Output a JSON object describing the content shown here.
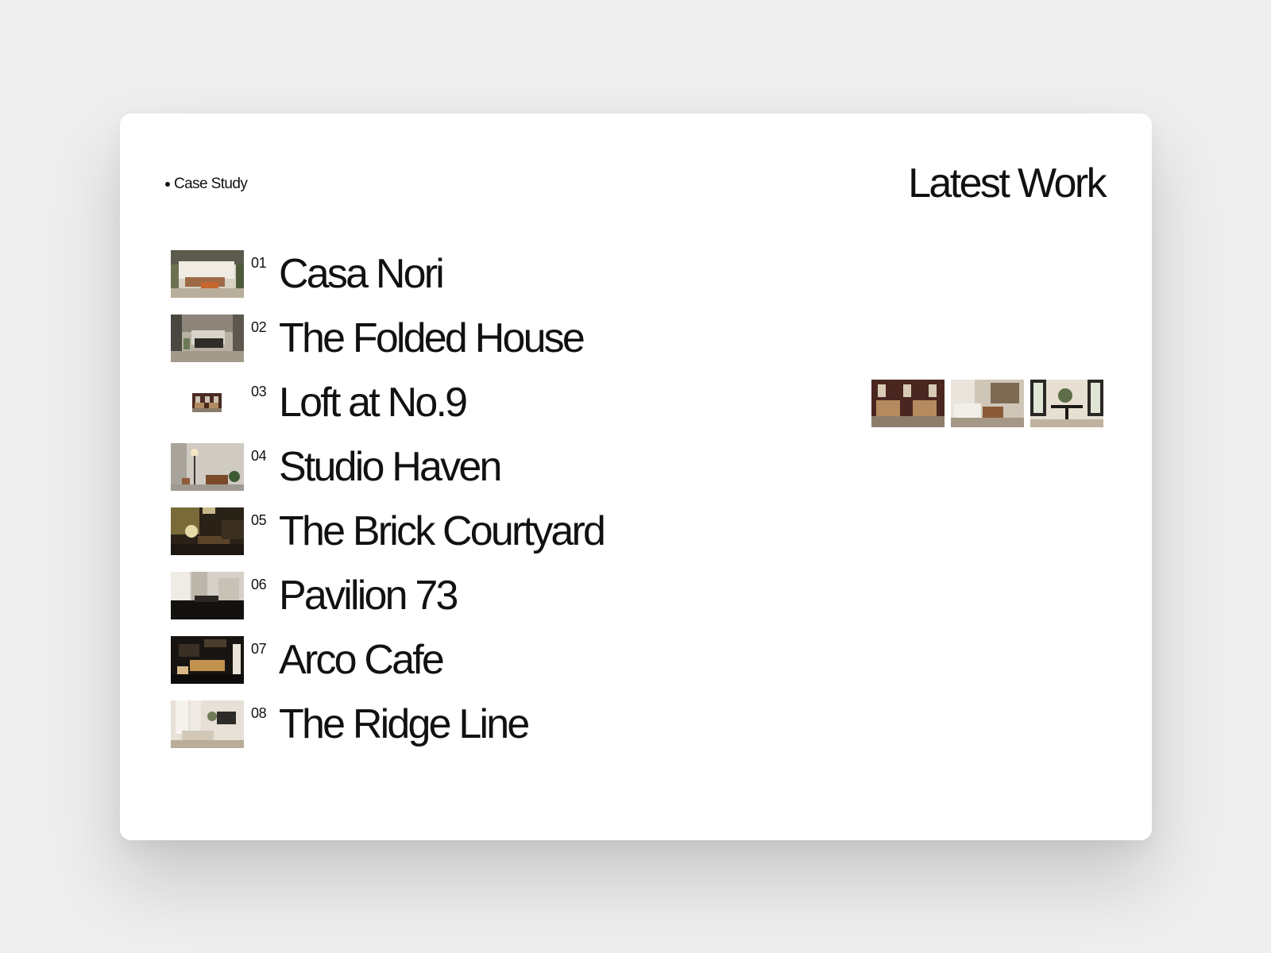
{
  "header": {
    "eyebrow": "Case Study",
    "title": "Latest Work"
  },
  "projects": [
    {
      "number": "01",
      "name": "Casa Nori"
    },
    {
      "number": "02",
      "name": "The Folded House"
    },
    {
      "number": "03",
      "name": "Loft at No.9"
    },
    {
      "number": "04",
      "name": "Studio Haven"
    },
    {
      "number": "05",
      "name": "The Brick Courtyard"
    },
    {
      "number": "06",
      "name": "Pavilion 73"
    },
    {
      "number": "07",
      "name": "Arco Cafe"
    },
    {
      "number": "08",
      "name": "The Ridge Line"
    }
  ],
  "colors": {
    "page_background": "#eeeeee",
    "card_background": "#ffffff",
    "text": "#111111"
  }
}
